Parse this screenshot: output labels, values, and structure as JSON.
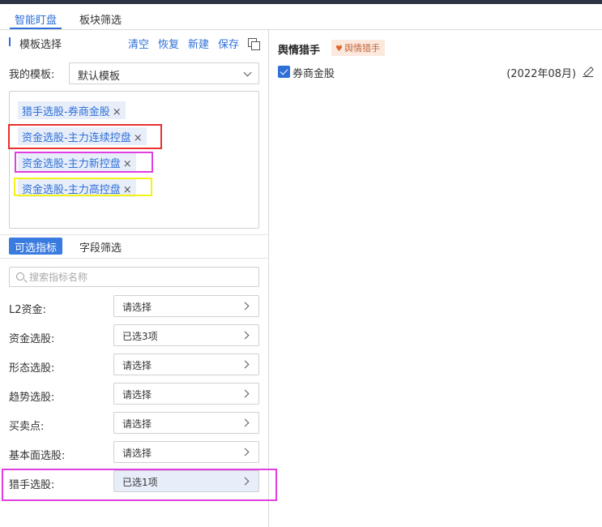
{
  "tabs": [
    {
      "label": "智能盯盘",
      "active": true
    },
    {
      "label": "板块筛选",
      "active": false
    }
  ],
  "template": {
    "title": "模板选择",
    "actions": {
      "clear": "清空",
      "restore": "恢复",
      "new": "新建",
      "save": "保存"
    },
    "my_template_label": "我的模板:",
    "selected_template": "默认模板",
    "tags": [
      "猎手选股-券商金股",
      "资金选股-主力连续控盘",
      "资金选股-主力新控盘",
      "资金选股-主力高控盘"
    ],
    "tag_remove_glyph": "×"
  },
  "indicator_tabs": [
    {
      "label": "可选指标",
      "active": true
    },
    {
      "label": "字段筛选",
      "active": false
    }
  ],
  "search": {
    "placeholder": "搜索指标名称",
    "value": ""
  },
  "indicators": [
    {
      "label": "L2资金:",
      "value": "请选择"
    },
    {
      "label": "资金选股:",
      "value": "已选3项"
    },
    {
      "label": "形态选股:",
      "value": "请选择"
    },
    {
      "label": "趋势选股:",
      "value": "请选择"
    },
    {
      "label": "买卖点:",
      "value": "请选择"
    },
    {
      "label": "基本面选股:",
      "value": "请选择"
    },
    {
      "label": "猎手选股:",
      "value": "已选1项"
    }
  ],
  "right_panel": {
    "title": "舆情猎手",
    "badge": "舆情猎手",
    "items": [
      {
        "name": "券商金股",
        "date": "(2022年08月)",
        "checked": true
      }
    ]
  },
  "colors": {
    "accent": "#2e6fd8",
    "highlight_red": "#e8302f",
    "highlight_magenta": "#e03ee0",
    "highlight_yellow": "#f3f31a"
  }
}
